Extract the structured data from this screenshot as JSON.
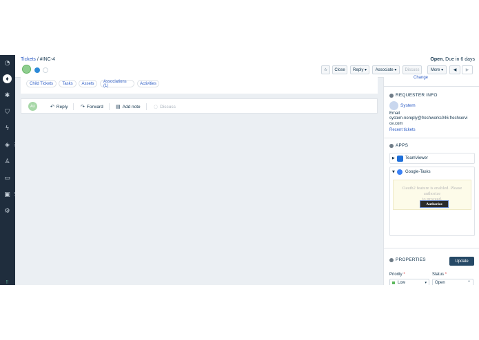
{
  "header": {
    "breadcrumb_link": "Tickets",
    "breadcrumb_sep": " / ",
    "ticket_id": "#INC-4",
    "status": "Open",
    "due_text": ", Due in 6 days",
    "toolbar": {
      "star_icon": "star-icon",
      "close_label": "Close",
      "reply_label": "Reply ▾",
      "associate_label": "Associate ▾",
      "discuss_label": "Discuss",
      "more_label": "More ▾",
      "prev_icon": "◀",
      "next_icon": "▶"
    }
  },
  "tabs": [
    "Child Tickets",
    "Tasks",
    "Assets",
    "Associations (1)",
    "Activities"
  ],
  "reply_bar": {
    "avatar_initials": "AU",
    "reply_label": "Reply",
    "forward_label": "Forward",
    "add_note_label": "Add note",
    "discuss_label": "Discuss"
  },
  "right_panel": {
    "change_link": "Change",
    "requester_title": "REQUESTER INFO",
    "requester_name": "System",
    "email_label": "Email",
    "email_value_1": "system-noreply@freshworks046.freshservi",
    "email_value_2": "ce.com",
    "recent_tickets": "Recent tickets",
    "apps_title": "APPS",
    "app1": "TeamViewer",
    "app2": "Google-Tasks",
    "oauth_message_1": "Oauth2 feature is enabled. Please authorize",
    "oauth_message_2": "to proceed.",
    "authorize_label": "Authorize",
    "properties_title": "PROPERTIES",
    "update_label": "Update",
    "priority_label": "Priority",
    "status_label": "Status",
    "priority_value": "Low",
    "status_value": "Open"
  },
  "colors": {
    "accent": "#2c5cc5",
    "nav_bg": "#1f2d3d",
    "primary_button": "#264966",
    "priority_low": "#5cb85c",
    "required": "#d72d30"
  }
}
